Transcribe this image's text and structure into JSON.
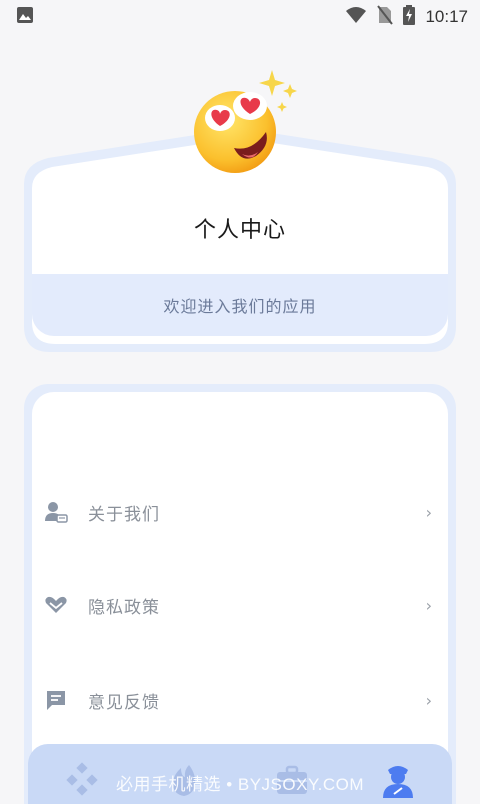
{
  "status_bar": {
    "time": "10:17",
    "icons": [
      "image-notification-icon",
      "wifi-icon",
      "no-sim-icon",
      "battery-charging-icon"
    ]
  },
  "profile": {
    "title": "个人中心",
    "welcome": "欢迎进入我们的应用",
    "avatar_icon": "heart-eyes-emoji-icon"
  },
  "menu": {
    "items": [
      {
        "label": "关于我们",
        "icon": "user-card-icon"
      },
      {
        "label": "隐私政策",
        "icon": "handshake-heart-icon"
      },
      {
        "label": "意见反馈",
        "icon": "feedback-message-icon"
      }
    ],
    "chevron": "›"
  },
  "bottom_nav": {
    "items": [
      {
        "icon": "apps-diamond-icon",
        "active": false
      },
      {
        "icon": "fire-icon",
        "active": false
      },
      {
        "icon": "briefcase-icon",
        "active": false
      },
      {
        "icon": "person-profile-icon",
        "active": true
      }
    ],
    "watermark": "必用手机精选 • BYJSOXY.COM"
  },
  "colors": {
    "accent": "#4d7cf0",
    "card_border": "#e4ecfb",
    "nav_bg": "#c9d9f6"
  }
}
